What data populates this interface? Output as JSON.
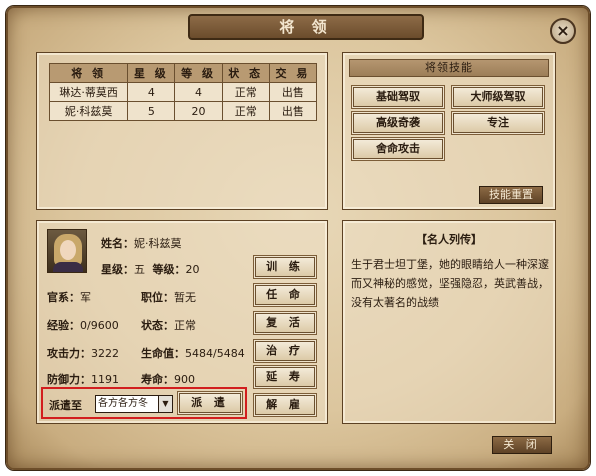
{
  "window": {
    "title": "将 领",
    "close_icon": "×"
  },
  "generals_table": {
    "headers": [
      "将 领",
      "星 级",
      "等 级",
      "状 态",
      "交 易"
    ],
    "rows": [
      [
        "琳达·蒂莫西",
        "4",
        "4",
        "正常",
        "出售"
      ],
      [
        "妮·科兹莫",
        "5",
        "20",
        "正常",
        "出售"
      ]
    ]
  },
  "skills": {
    "header": "将领技能",
    "buttons": [
      "基础驾驭",
      "大师级驾驭",
      "高级奇袭",
      "专注",
      "舍命攻击"
    ],
    "reset": "技能重置"
  },
  "detail": {
    "name_label": "姓名：",
    "name": "妮·科兹莫",
    "star_label": "星级：",
    "star": "五",
    "level_label": "等级：",
    "level": "20",
    "branch_label": "官系：",
    "branch": "军",
    "post_label": "职位：",
    "post": "暂无",
    "exp_label": "经验：",
    "exp": "0/9600",
    "status_label": "状态：",
    "status": "正常",
    "attack_label": "攻击力：",
    "attack": "3222",
    "hp_label": "生命值：",
    "hp": "5484/5484",
    "defense_label": "防御力：",
    "defense": "1191",
    "life_label": "寿命：",
    "life": "900",
    "actions": [
      "训 练",
      "任 命",
      "复 活",
      "治 疗",
      "延 寿",
      "解 雇"
    ],
    "dispatch_label": "派遣至",
    "dispatch_select": "各方各方冬",
    "dispatch_button": "派 遣"
  },
  "bio": {
    "title": "【名人列传】",
    "text": "生于君士坦丁堡，她的眼睛给人一种深邃而又神秘的感觉，坚强隐忍，英武善战，没有太著名的战绩"
  },
  "footer": {
    "close_label": "关 闭"
  }
}
